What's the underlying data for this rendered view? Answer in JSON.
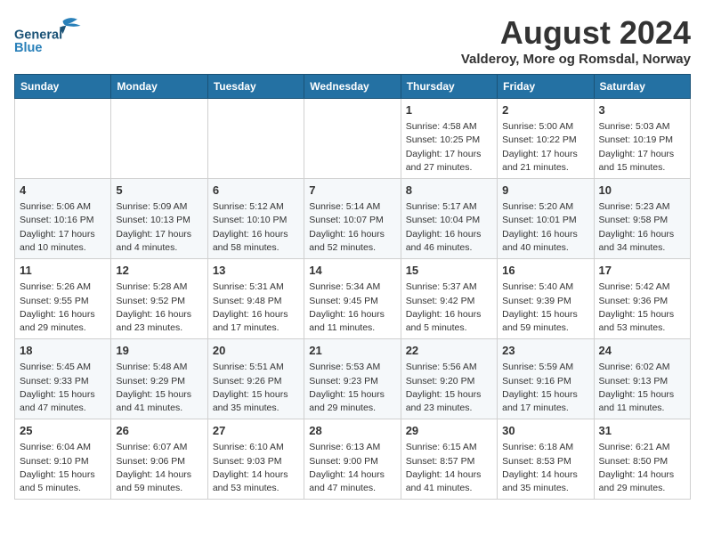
{
  "header": {
    "logo_general": "General",
    "logo_blue": "Blue",
    "month_year": "August 2024",
    "location": "Valderoy, More og Romsdal, Norway"
  },
  "weekdays": [
    "Sunday",
    "Monday",
    "Tuesday",
    "Wednesday",
    "Thursday",
    "Friday",
    "Saturday"
  ],
  "weeks": [
    [
      {
        "day": "",
        "info": ""
      },
      {
        "day": "",
        "info": ""
      },
      {
        "day": "",
        "info": ""
      },
      {
        "day": "",
        "info": ""
      },
      {
        "day": "1",
        "info": "Sunrise: 4:58 AM\nSunset: 10:25 PM\nDaylight: 17 hours\nand 27 minutes."
      },
      {
        "day": "2",
        "info": "Sunrise: 5:00 AM\nSunset: 10:22 PM\nDaylight: 17 hours\nand 21 minutes."
      },
      {
        "day": "3",
        "info": "Sunrise: 5:03 AM\nSunset: 10:19 PM\nDaylight: 17 hours\nand 15 minutes."
      }
    ],
    [
      {
        "day": "4",
        "info": "Sunrise: 5:06 AM\nSunset: 10:16 PM\nDaylight: 17 hours\nand 10 minutes."
      },
      {
        "day": "5",
        "info": "Sunrise: 5:09 AM\nSunset: 10:13 PM\nDaylight: 17 hours\nand 4 minutes."
      },
      {
        "day": "6",
        "info": "Sunrise: 5:12 AM\nSunset: 10:10 PM\nDaylight: 16 hours\nand 58 minutes."
      },
      {
        "day": "7",
        "info": "Sunrise: 5:14 AM\nSunset: 10:07 PM\nDaylight: 16 hours\nand 52 minutes."
      },
      {
        "day": "8",
        "info": "Sunrise: 5:17 AM\nSunset: 10:04 PM\nDaylight: 16 hours\nand 46 minutes."
      },
      {
        "day": "9",
        "info": "Sunrise: 5:20 AM\nSunset: 10:01 PM\nDaylight: 16 hours\nand 40 minutes."
      },
      {
        "day": "10",
        "info": "Sunrise: 5:23 AM\nSunset: 9:58 PM\nDaylight: 16 hours\nand 34 minutes."
      }
    ],
    [
      {
        "day": "11",
        "info": "Sunrise: 5:26 AM\nSunset: 9:55 PM\nDaylight: 16 hours\nand 29 minutes."
      },
      {
        "day": "12",
        "info": "Sunrise: 5:28 AM\nSunset: 9:52 PM\nDaylight: 16 hours\nand 23 minutes."
      },
      {
        "day": "13",
        "info": "Sunrise: 5:31 AM\nSunset: 9:48 PM\nDaylight: 16 hours\nand 17 minutes."
      },
      {
        "day": "14",
        "info": "Sunrise: 5:34 AM\nSunset: 9:45 PM\nDaylight: 16 hours\nand 11 minutes."
      },
      {
        "day": "15",
        "info": "Sunrise: 5:37 AM\nSunset: 9:42 PM\nDaylight: 16 hours\nand 5 minutes."
      },
      {
        "day": "16",
        "info": "Sunrise: 5:40 AM\nSunset: 9:39 PM\nDaylight: 15 hours\nand 59 minutes."
      },
      {
        "day": "17",
        "info": "Sunrise: 5:42 AM\nSunset: 9:36 PM\nDaylight: 15 hours\nand 53 minutes."
      }
    ],
    [
      {
        "day": "18",
        "info": "Sunrise: 5:45 AM\nSunset: 9:33 PM\nDaylight: 15 hours\nand 47 minutes."
      },
      {
        "day": "19",
        "info": "Sunrise: 5:48 AM\nSunset: 9:29 PM\nDaylight: 15 hours\nand 41 minutes."
      },
      {
        "day": "20",
        "info": "Sunrise: 5:51 AM\nSunset: 9:26 PM\nDaylight: 15 hours\nand 35 minutes."
      },
      {
        "day": "21",
        "info": "Sunrise: 5:53 AM\nSunset: 9:23 PM\nDaylight: 15 hours\nand 29 minutes."
      },
      {
        "day": "22",
        "info": "Sunrise: 5:56 AM\nSunset: 9:20 PM\nDaylight: 15 hours\nand 23 minutes."
      },
      {
        "day": "23",
        "info": "Sunrise: 5:59 AM\nSunset: 9:16 PM\nDaylight: 15 hours\nand 17 minutes."
      },
      {
        "day": "24",
        "info": "Sunrise: 6:02 AM\nSunset: 9:13 PM\nDaylight: 15 hours\nand 11 minutes."
      }
    ],
    [
      {
        "day": "25",
        "info": "Sunrise: 6:04 AM\nSunset: 9:10 PM\nDaylight: 15 hours\nand 5 minutes."
      },
      {
        "day": "26",
        "info": "Sunrise: 6:07 AM\nSunset: 9:06 PM\nDaylight: 14 hours\nand 59 minutes."
      },
      {
        "day": "27",
        "info": "Sunrise: 6:10 AM\nSunset: 9:03 PM\nDaylight: 14 hours\nand 53 minutes."
      },
      {
        "day": "28",
        "info": "Sunrise: 6:13 AM\nSunset: 9:00 PM\nDaylight: 14 hours\nand 47 minutes."
      },
      {
        "day": "29",
        "info": "Sunrise: 6:15 AM\nSunset: 8:57 PM\nDaylight: 14 hours\nand 41 minutes."
      },
      {
        "day": "30",
        "info": "Sunrise: 6:18 AM\nSunset: 8:53 PM\nDaylight: 14 hours\nand 35 minutes."
      },
      {
        "day": "31",
        "info": "Sunrise: 6:21 AM\nSunset: 8:50 PM\nDaylight: 14 hours\nand 29 minutes."
      }
    ]
  ]
}
